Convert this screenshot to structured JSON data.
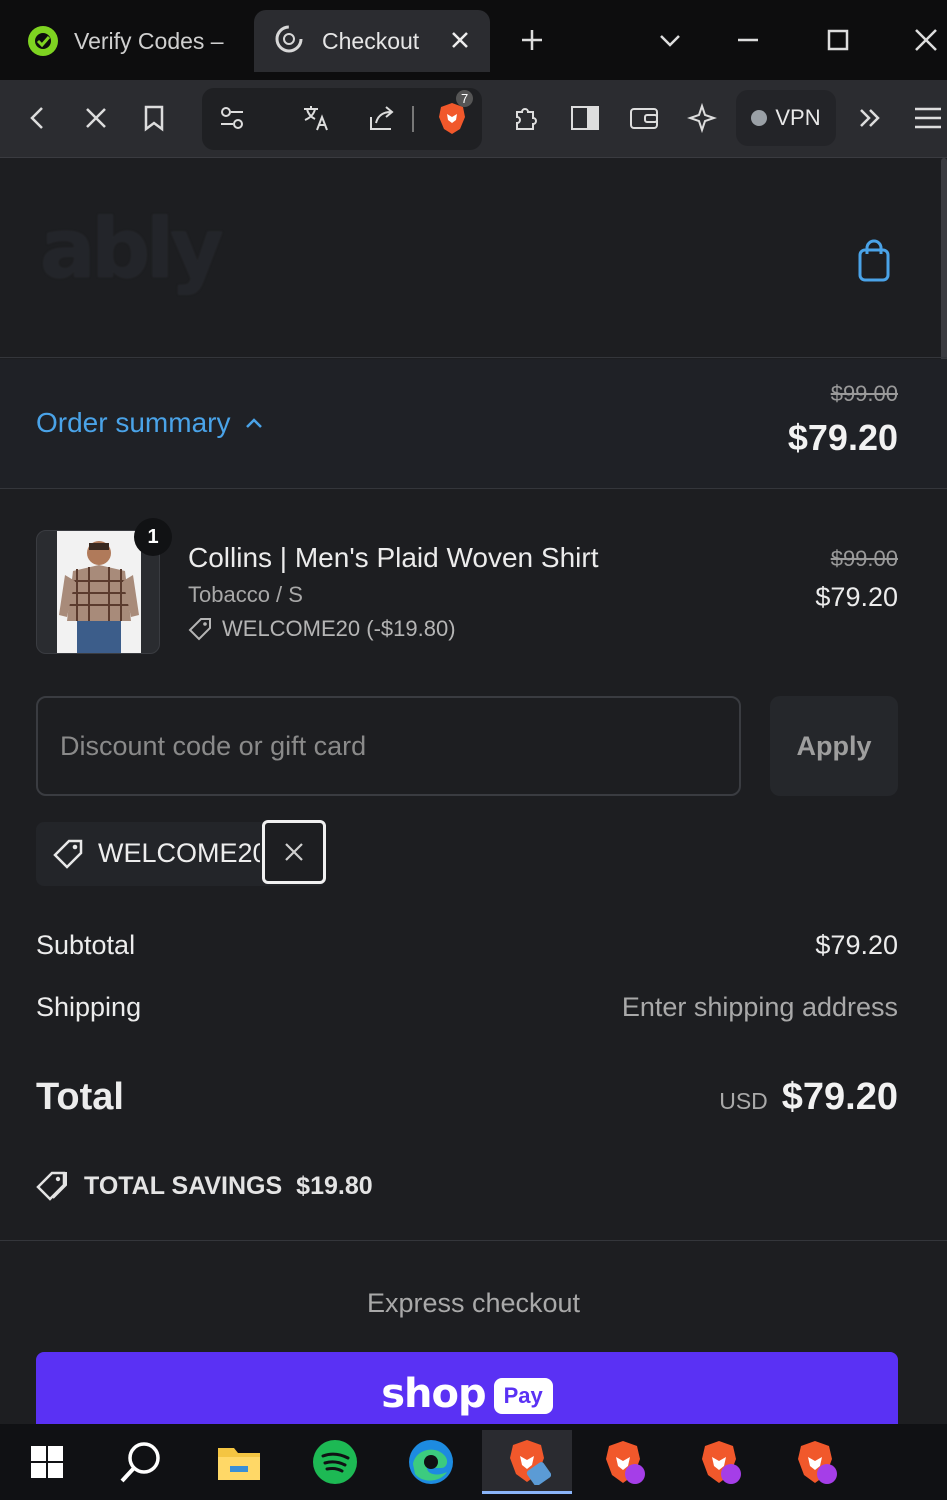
{
  "browser": {
    "tabs": [
      {
        "title": "Verify Codes –",
        "favicon": "verify-codes-icon"
      },
      {
        "title": "Checkout",
        "favicon": "loading-spinner-icon",
        "active": true
      }
    ],
    "brave_badge_count": "7",
    "vpn_label": "VPN"
  },
  "store": {
    "logo_text": "ably"
  },
  "summary": {
    "toggle_label": "Order summary",
    "original_total": "$99.00",
    "total": "$79.20"
  },
  "line_item": {
    "quantity": "1",
    "name": "Collins | Men's Plaid Woven Shirt",
    "variant": "Tobacco / S",
    "discount": "WELCOME20 (-$19.80)",
    "original_price": "$99.00",
    "price": "$79.20"
  },
  "discount_form": {
    "placeholder": "Discount code or gift card",
    "value": "",
    "apply_label": "Apply",
    "applied_code": "WELCOME20"
  },
  "totals": {
    "subtotal_label": "Subtotal",
    "subtotal_value": "$79.20",
    "shipping_label": "Shipping",
    "shipping_value": "Enter shipping address",
    "total_label": "Total",
    "currency": "USD",
    "total_value": "$79.20",
    "savings_label": "TOTAL SAVINGS",
    "savings_value": "$19.80"
  },
  "express": {
    "title": "Express checkout",
    "shop_text": "shop",
    "pay_badge": "Pay"
  },
  "colors": {
    "accent_link": "#4aa3e8",
    "shop_pay": "#5a31f4",
    "page_bg": "#1d1e21"
  },
  "taskbar": {
    "items": [
      "windows-start-icon",
      "search-icon",
      "file-explorer-icon",
      "spotify-icon",
      "edge-icon",
      "brave-icon",
      "brave-icon",
      "brave-icon",
      "brave-icon"
    ]
  }
}
